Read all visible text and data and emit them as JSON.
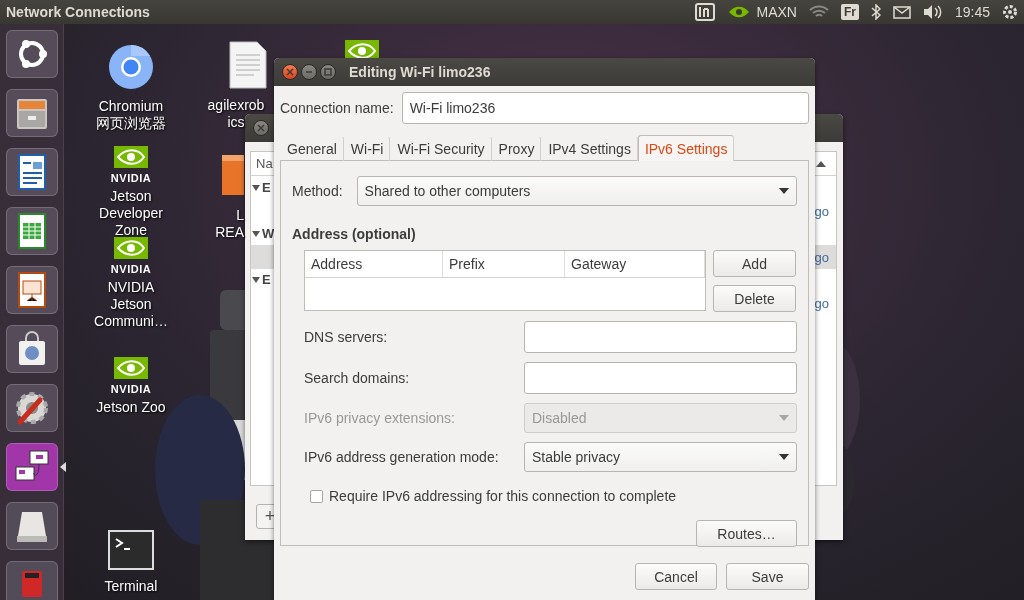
{
  "top_bar": {
    "title": "Network Connections",
    "power_mode": "MAXN",
    "keyboard": "Fr",
    "clock": "19:45"
  },
  "launcher": [
    {
      "kind": "ubuntu",
      "active": false
    },
    {
      "kind": "files",
      "active": false
    },
    {
      "kind": "writer",
      "active": false
    },
    {
      "kind": "calc",
      "active": false
    },
    {
      "kind": "impress",
      "active": false
    },
    {
      "kind": "store",
      "active": false
    },
    {
      "kind": "settings",
      "active": false
    },
    {
      "kind": "network",
      "active": true
    },
    {
      "kind": "drive",
      "active": false
    },
    {
      "kind": "sdcard",
      "active": false
    }
  ],
  "desktop_icons": [
    {
      "kind": "chromium",
      "lines": [
        "Chromium",
        "网页浏览器"
      ]
    },
    {
      "kind": "document",
      "lines": [
        "agilexrob",
        "ics"
      ]
    },
    {
      "kind": "nvidia"
    },
    {
      "kind": "nvidia",
      "logo_text": "NVIDIA",
      "lines": [
        "Jetson",
        "Developer",
        "Zone"
      ]
    },
    {
      "kind": "folder",
      "lines": [
        "L",
        "REA"
      ]
    },
    {
      "kind": "nvidia",
      "logo_text": "NVIDIA",
      "lines": [
        "NVIDIA",
        "Jetson",
        "Communi…"
      ]
    },
    {
      "kind": "nvidia",
      "logo_text": "NVIDIA",
      "lines": [
        "Jetson Zoo"
      ]
    },
    {
      "kind": "terminal",
      "lines": [
        "Terminal"
      ]
    }
  ],
  "back_window": {
    "column": "Na",
    "groups": [
      "E",
      "W",
      "E"
    ],
    "rows": [
      {
        "text": "go",
        "selected": false
      },
      {
        "text": "go",
        "selected": true
      },
      {
        "text": "go",
        "selected": false
      }
    ],
    "add_button": "+"
  },
  "dialog": {
    "title": "Editing Wi-Fi limo236",
    "connection_name": {
      "label": "Connection name:",
      "value": "Wi-Fi limo236"
    },
    "tabs": [
      {
        "label": "General",
        "selected": false
      },
      {
        "label": "Wi-Fi",
        "selected": false
      },
      {
        "label": "Wi-Fi Security",
        "selected": false
      },
      {
        "label": "Proxy",
        "selected": false
      },
      {
        "label": "IPv4 Settings",
        "selected": false
      },
      {
        "label": "IPv6 Settings",
        "selected": true
      }
    ],
    "method": {
      "label": "Method:",
      "value": "Shared to other computers"
    },
    "address": {
      "heading": "Address (optional)",
      "columns": [
        "Address",
        "Prefix",
        "Gateway"
      ],
      "buttons": [
        "Add",
        "Delete"
      ]
    },
    "fields": [
      {
        "kind": "text",
        "label": "DNS servers:",
        "disabled": false
      },
      {
        "kind": "text",
        "label": "Search domains:",
        "disabled": false
      },
      {
        "kind": "select",
        "label": "IPv6 privacy extensions:",
        "value": "Disabled",
        "disabled": true
      },
      {
        "kind": "select",
        "label": "IPv6 address generation mode:",
        "value": "Stable privacy",
        "disabled": false
      }
    ],
    "require": {
      "label": "Require IPv6 addressing for this connection to complete",
      "checked": false
    },
    "routes_button": "Routes…",
    "buttons": [
      "Cancel",
      "Save"
    ]
  }
}
